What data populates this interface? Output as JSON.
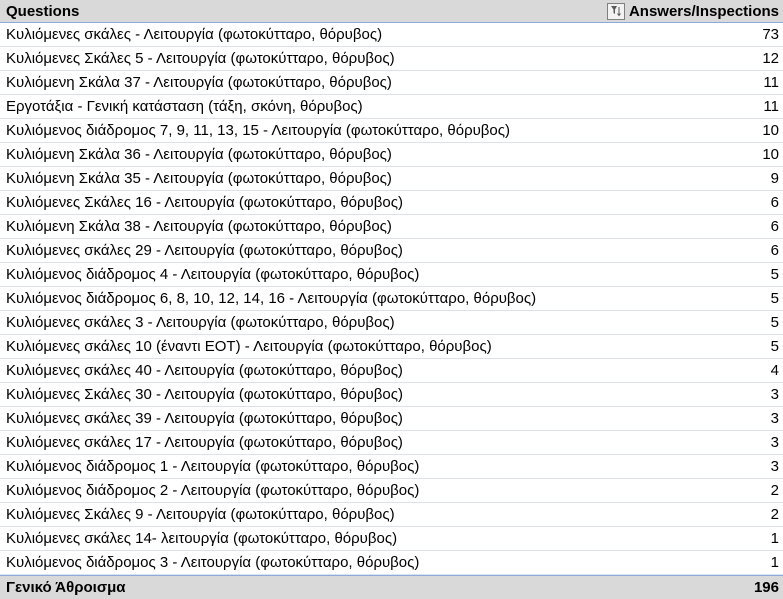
{
  "header": {
    "questions_label": "Questions",
    "answers_label": "Answers/Inspections",
    "filter_icon": "filter-sort-icon"
  },
  "rows": [
    {
      "question": "Κυλιόμενες σκάλες - Λειτουργία (φωτοκύτταρο, θόρυβος)",
      "count": "73"
    },
    {
      "question": "Κυλιόμενες Σκάλες 5 - Λειτουργία (φωτοκύτταρο, θόρυβος)",
      "count": "12"
    },
    {
      "question": "Κυλιόμενη Σκάλα 37 - Λειτουργία (φωτοκύτταρο, θόρυβος)",
      "count": "11"
    },
    {
      "question": "Εργοτάξια - Γενική κατάσταση (τάξη, σκόνη, θόρυβος)",
      "count": "11"
    },
    {
      "question": "Κυλιόμενος διάδρομος 7, 9, 11, 13, 15 - Λειτουργία (φωτοκύτταρο, θόρυβος)",
      "count": "10"
    },
    {
      "question": "Κυλιόμενη Σκάλα 36 - Λειτουργία (φωτοκύτταρο, θόρυβος)",
      "count": "10"
    },
    {
      "question": "Κυλιόμενη Σκάλα 35 - Λειτουργία (φωτοκύτταρο, θόρυβος)",
      "count": "9"
    },
    {
      "question": "Κυλιόμενες Σκάλες 16 - Λειτουργία (φωτοκύτταρο, θόρυβος)",
      "count": "6"
    },
    {
      "question": "Κυλιόμενη Σκάλα 38 - Λειτουργία (φωτοκύτταρο, θόρυβος)",
      "count": "6"
    },
    {
      "question": "Κυλιόμενες σκάλες 29 - Λειτουργία (φωτοκύτταρο, θόρυβος)",
      "count": "6"
    },
    {
      "question": "Κυλιόμενος διάδρομος 4 - Λειτουργία (φωτοκύτταρο, θόρυβος)",
      "count": "5"
    },
    {
      "question": "Κυλιόμενος διάδρομος 6, 8, 10, 12, 14, 16 - Λειτουργία (φωτοκύτταρο, θόρυβος)",
      "count": "5"
    },
    {
      "question": "Κυλιόμενες σκάλες 3 - Λειτουργία (φωτοκύτταρο, θόρυβος)",
      "count": "5"
    },
    {
      "question": "Κυλιόμενες σκάλες 10 (έναντι ΕΟΤ) - Λειτουργία (φωτοκύτταρο, θόρυβος)",
      "count": "5"
    },
    {
      "question": "Κυλιόμενες σκάλες 40 - Λειτουργία (φωτοκύτταρο, θόρυβος)",
      "count": "4"
    },
    {
      "question": "Κυλιόμενες Σκάλες 30 - Λειτουργία (φωτοκύτταρο, θόρυβος)",
      "count": "3"
    },
    {
      "question": "Κυλιόμενες σκάλες 39 - Λειτουργία (φωτοκύτταρο, θόρυβος)",
      "count": "3"
    },
    {
      "question": "Κυλιόμενες σκάλες 17 - Λειτουργία (φωτοκύτταρο, θόρυβος)",
      "count": "3"
    },
    {
      "question": "Κυλιόμενος διάδρομος 1 - Λειτουργία (φωτοκύτταρο, θόρυβος)",
      "count": "3"
    },
    {
      "question": "Κυλιόμενος διάδρομος 2 - Λειτουργία (φωτοκύτταρο, θόρυβος)",
      "count": "2"
    },
    {
      "question": "Κυλιόμενες Σκάλες 9 - Λειτουργία (φωτοκύτταρο, θόρυβος)",
      "count": "2"
    },
    {
      "question": "Κυλιόμενες σκάλες 14- λειτουργία (φωτοκύτταρο, θόρυβος)",
      "count": "1"
    },
    {
      "question": "Κυλιόμενος διάδρομος 3 - Λειτουργία (φωτοκύτταρο, θόρυβος)",
      "count": "1"
    }
  ],
  "total": {
    "label": "Γενικό Άθροισμα",
    "value": "196"
  },
  "colors": {
    "header_bg": "#d9d9d9",
    "row_border": "#d9e1f2",
    "accent_border": "#8eaadb"
  }
}
